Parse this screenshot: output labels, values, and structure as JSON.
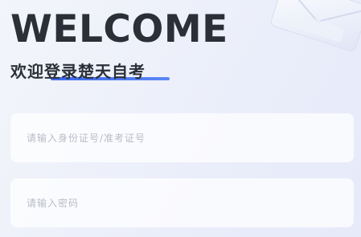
{
  "header": {
    "welcome": "WELCOME",
    "subtitle": "欢迎登录楚天自考",
    "accent_color": "#3d6af0"
  },
  "form": {
    "id_field": {
      "value": "",
      "placeholder": "请输入身份证号/准考证号"
    },
    "password_field": {
      "value": "",
      "placeholder": "请输入密码"
    }
  }
}
